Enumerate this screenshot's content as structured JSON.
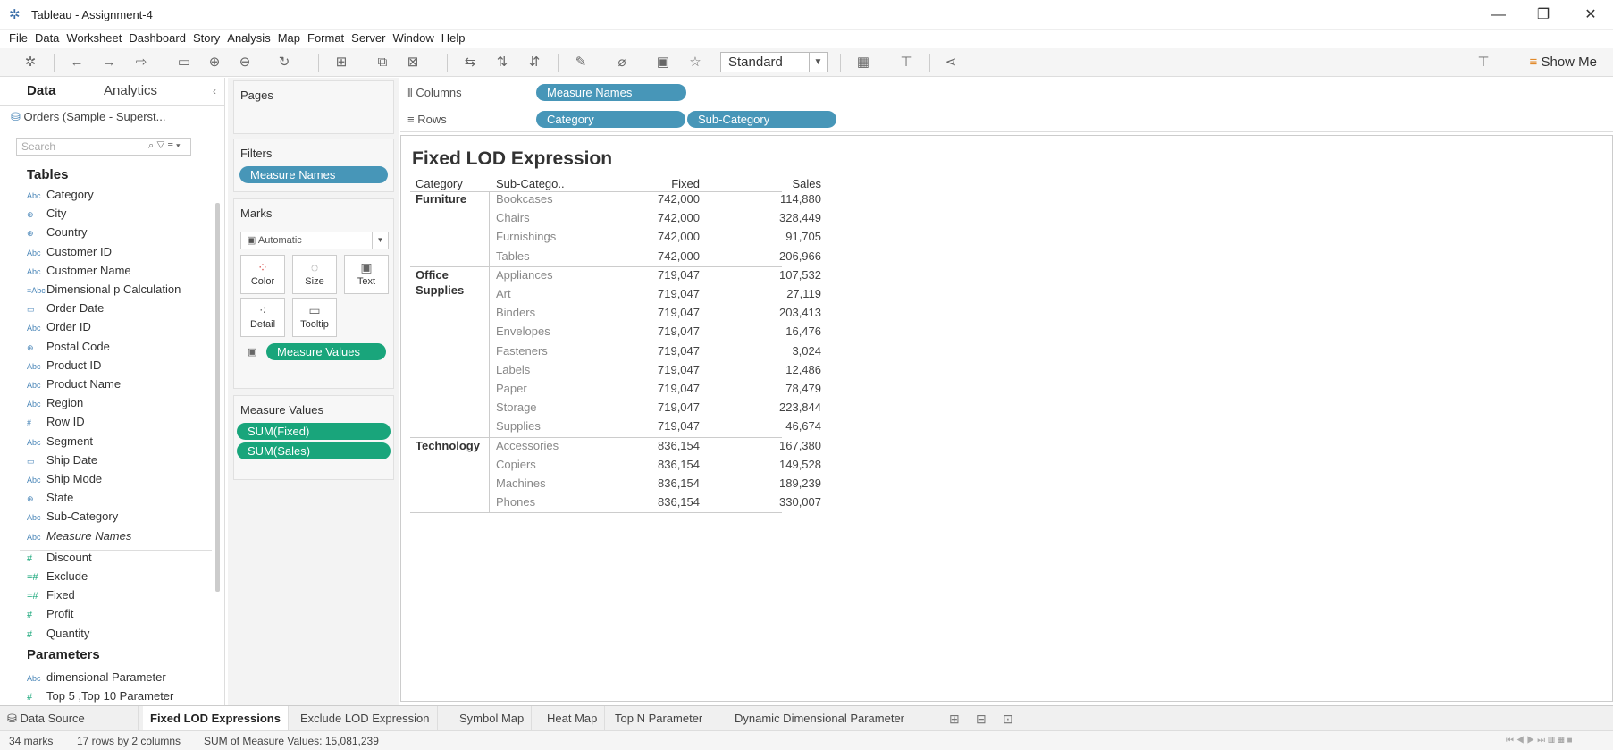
{
  "window": {
    "title": "Tableau - Assignment-4"
  },
  "menu": [
    "File",
    "Data",
    "Worksheet",
    "Dashboard",
    "Story",
    "Analysis",
    "Map",
    "Format",
    "Server",
    "Window",
    "Help"
  ],
  "toolbar": {
    "view_size": "Standard",
    "show_me": "Show Me"
  },
  "data_pane": {
    "tabs": [
      "Data",
      "Analytics"
    ],
    "datasource": "Orders (Sample - Superst...",
    "search_placeholder": "Search",
    "tables_header": "Tables",
    "dimensions": [
      {
        "label": "Category",
        "icon": "Abc"
      },
      {
        "label": "City",
        "icon": "globe"
      },
      {
        "label": "Country",
        "icon": "globe"
      },
      {
        "label": "Customer ID",
        "icon": "Abc"
      },
      {
        "label": "Customer Name",
        "icon": "Abc"
      },
      {
        "label": "Dimensional p Calculation",
        "icon": "=Abc"
      },
      {
        "label": "Order Date",
        "icon": "date"
      },
      {
        "label": "Order ID",
        "icon": "Abc"
      },
      {
        "label": "Postal Code",
        "icon": "globe"
      },
      {
        "label": "Product ID",
        "icon": "Abc"
      },
      {
        "label": "Product Name",
        "icon": "Abc"
      },
      {
        "label": "Region",
        "icon": "Abc"
      },
      {
        "label": "Row ID",
        "icon": "#"
      },
      {
        "label": "Segment",
        "icon": "Abc"
      },
      {
        "label": "Ship Date",
        "icon": "date"
      },
      {
        "label": "Ship Mode",
        "icon": "Abc"
      },
      {
        "label": "State",
        "icon": "globe"
      },
      {
        "label": "Sub-Category",
        "icon": "Abc"
      },
      {
        "label": "Measure Names",
        "icon": "Abc"
      }
    ],
    "measures": [
      {
        "label": "Discount",
        "icon": "#"
      },
      {
        "label": "Exclude",
        "icon": "=#"
      },
      {
        "label": "Fixed",
        "icon": "=#"
      },
      {
        "label": "Profit",
        "icon": "#"
      },
      {
        "label": "Quantity",
        "icon": "#"
      }
    ],
    "parameters_header": "Parameters",
    "parameters": [
      {
        "label": "dimensional Parameter",
        "icon": "Abc"
      },
      {
        "label": "Top 5 ,Top 10 Parameter",
        "icon": "#"
      }
    ]
  },
  "shelves": {
    "pages": "Pages",
    "filters": "Filters",
    "filter_pills": [
      "Measure Names"
    ],
    "marks": "Marks",
    "mark_type": "Automatic",
    "mark_buttons": [
      "Color",
      "Size",
      "Text",
      "Detail",
      "Tooltip"
    ],
    "text_pill": "Measure Values",
    "measure_values_header": "Measure Values",
    "measure_values_pills": [
      "SUM(Fixed)",
      "SUM(Sales)"
    ],
    "columns_label": "Columns",
    "columns_pills": [
      "Measure Names"
    ],
    "rows_label": "Rows",
    "rows_pills": [
      "Category",
      "Sub-Category"
    ]
  },
  "view": {
    "title": "Fixed LOD Expression",
    "headers": [
      "Category",
      "Sub-Catego..",
      "Fixed",
      "Sales"
    ],
    "groups": [
      {
        "category": "Furniture",
        "rows": [
          {
            "sub": "Bookcases",
            "fixed": "742,000",
            "sales": "114,880"
          },
          {
            "sub": "Chairs",
            "fixed": "742,000",
            "sales": "328,449"
          },
          {
            "sub": "Furnishings",
            "fixed": "742,000",
            "sales": "91,705"
          },
          {
            "sub": "Tables",
            "fixed": "742,000",
            "sales": "206,966"
          }
        ]
      },
      {
        "category": "Office\nSupplies",
        "rows": [
          {
            "sub": "Appliances",
            "fixed": "719,047",
            "sales": "107,532"
          },
          {
            "sub": "Art",
            "fixed": "719,047",
            "sales": "27,119"
          },
          {
            "sub": "Binders",
            "fixed": "719,047",
            "sales": "203,413"
          },
          {
            "sub": "Envelopes",
            "fixed": "719,047",
            "sales": "16,476"
          },
          {
            "sub": "Fasteners",
            "fixed": "719,047",
            "sales": "3,024"
          },
          {
            "sub": "Labels",
            "fixed": "719,047",
            "sales": "12,486"
          },
          {
            "sub": "Paper",
            "fixed": "719,047",
            "sales": "78,479"
          },
          {
            "sub": "Storage",
            "fixed": "719,047",
            "sales": "223,844"
          },
          {
            "sub": "Supplies",
            "fixed": "719,047",
            "sales": "46,674"
          }
        ]
      },
      {
        "category": "Technology",
        "rows": [
          {
            "sub": "Accessories",
            "fixed": "836,154",
            "sales": "167,380"
          },
          {
            "sub": "Copiers",
            "fixed": "836,154",
            "sales": "149,528"
          },
          {
            "sub": "Machines",
            "fixed": "836,154",
            "sales": "189,239"
          },
          {
            "sub": "Phones",
            "fixed": "836,154",
            "sales": "330,007"
          }
        ]
      }
    ]
  },
  "sheet_tabs": {
    "datasource": "Data Source",
    "tabs": [
      "Fixed LOD Expressions",
      "Exclude LOD Expression",
      "Symbol Map",
      "Heat Map",
      "Top N Parameter",
      "Dynamic Dimensional Parameter"
    ],
    "active": "Fixed LOD Expressions"
  },
  "status": {
    "marks": "34 marks",
    "dims": "17 rows by 2 columns",
    "sum": "SUM of Measure Values: 15,081,239"
  },
  "colors": {
    "pill_blue": "#4796b8",
    "pill_green": "#19a57b"
  }
}
